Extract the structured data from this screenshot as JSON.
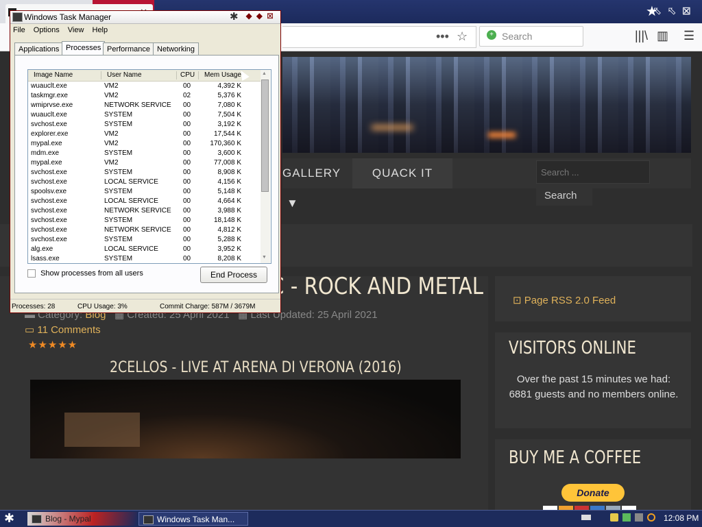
{
  "browser": {
    "search_placeholder": "Search"
  },
  "site": {
    "menu": {
      "gallery": "GALLERY",
      "quack": "QUACK IT"
    },
    "search_placeholder": "Search ...",
    "search_button": "Search",
    "article": {
      "title": "CELLO CROSSOVER MUSIC - ROCK AND METAL",
      "category_label": "Category:",
      "category": "Blog",
      "created": "Created: 25 April 2021",
      "updated": "Last Updated: 25 April 2021",
      "comments": "11 Comments",
      "rating": "★★★★★",
      "video_title": "2CELLOS - LIVE AT ARENA DI VERONA (2016)"
    },
    "sidebar": {
      "rss": "Page RSS 2.0 Feed",
      "visitors_title": "VISITORS ONLINE",
      "visitors_text": "Over the past 15 minutes we had: 6881 guests and no members online.",
      "coffee_title": "BUY ME A COFFEE",
      "donate": "Donate"
    }
  },
  "taskmgr": {
    "title": "Windows Task Manager",
    "menu": [
      "File",
      "Options",
      "View",
      "Help"
    ],
    "tabs": [
      "Applications",
      "Processes",
      "Performance",
      "Networking"
    ],
    "columns": [
      "Image Name",
      "User Name",
      "CPU",
      "Mem Usage"
    ],
    "processes": [
      [
        "wuauclt.exe",
        "VM2",
        "00",
        "4,392 K"
      ],
      [
        "taskmgr.exe",
        "VM2",
        "02",
        "5,376 K"
      ],
      [
        "wmiprvse.exe",
        "NETWORK SERVICE",
        "00",
        "7,080 K"
      ],
      [
        "wuauclt.exe",
        "SYSTEM",
        "00",
        "7,504 K"
      ],
      [
        "svchost.exe",
        "SYSTEM",
        "00",
        "3,192 K"
      ],
      [
        "explorer.exe",
        "VM2",
        "00",
        "17,544 K"
      ],
      [
        "mypal.exe",
        "VM2",
        "00",
        "170,360 K"
      ],
      [
        "mdm.exe",
        "SYSTEM",
        "00",
        "3,600 K"
      ],
      [
        "mypal.exe",
        "VM2",
        "00",
        "77,008 K"
      ],
      [
        "svchost.exe",
        "SYSTEM",
        "00",
        "8,908 K"
      ],
      [
        "svchost.exe",
        "LOCAL SERVICE",
        "00",
        "4,156 K"
      ],
      [
        "spoolsv.exe",
        "SYSTEM",
        "00",
        "5,148 K"
      ],
      [
        "svchost.exe",
        "LOCAL SERVICE",
        "00",
        "4,664 K"
      ],
      [
        "svchost.exe",
        "NETWORK SERVICE",
        "00",
        "3,988 K"
      ],
      [
        "svchost.exe",
        "SYSTEM",
        "00",
        "18,148 K"
      ],
      [
        "svchost.exe",
        "NETWORK SERVICE",
        "00",
        "4,812 K"
      ],
      [
        "svchost.exe",
        "SYSTEM",
        "00",
        "5,288 K"
      ],
      [
        "alg.exe",
        "LOCAL SERVICE",
        "00",
        "3,952 K"
      ],
      [
        "lsass.exe",
        "SYSTEM",
        "00",
        "8,208 K"
      ]
    ],
    "show_all_label": "Show processes from all users",
    "end_process": "End Process",
    "status": {
      "processes": "Processes: 28",
      "cpu": "CPU Usage: 3%",
      "commit": "Commit Charge: 587M / 3679M"
    }
  },
  "taskbar": {
    "items": [
      "Blog - Mypal",
      "Windows Task Man..."
    ],
    "clock": "12:08 PM"
  },
  "colors": {
    "accent": "#e0b25a",
    "stars": "#ef8a24",
    "taskbar": "#1d2b5c"
  }
}
